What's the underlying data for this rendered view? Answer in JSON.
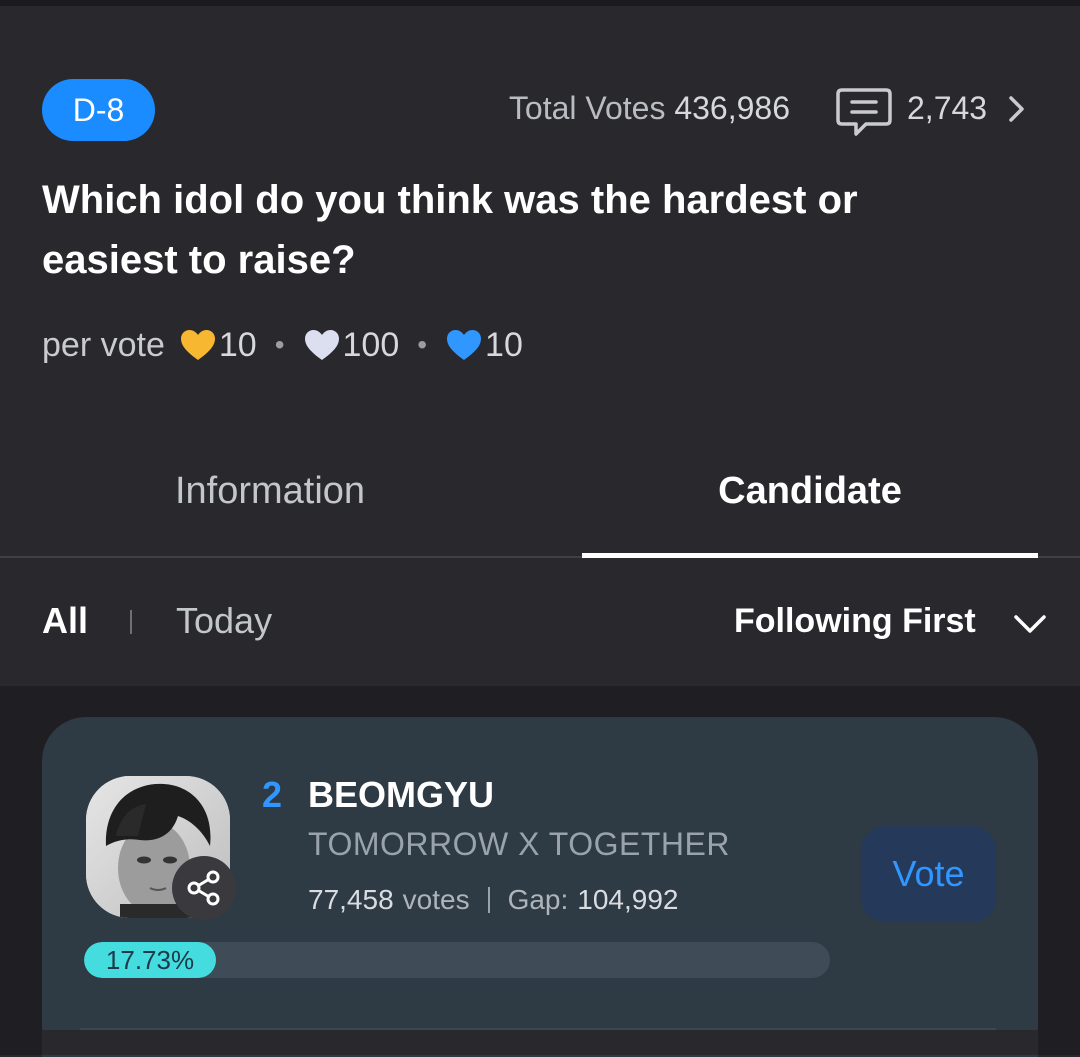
{
  "header": {
    "dday_badge": "D-8",
    "total_votes_label": "Total Votes",
    "total_votes_value": "436,986",
    "comment_count": "2,743"
  },
  "question": "Which idol do you think was the hardest or easiest to raise?",
  "per_vote": {
    "label": "per vote",
    "items": [
      {
        "heart": "gold-heart-icon",
        "color": "#f7b731",
        "value": "10"
      },
      {
        "heart": "white-heart-icon",
        "color": "#dcdff0",
        "value": "100"
      },
      {
        "heart": "blue-heart-icon",
        "color": "#2f97ff",
        "value": "10"
      }
    ]
  },
  "tabs": [
    {
      "label": "Information",
      "active": false
    },
    {
      "label": "Candidate",
      "active": true
    }
  ],
  "filters": {
    "all": "All",
    "today": "Today",
    "sort": "Following First"
  },
  "candidate": {
    "rank": "2",
    "name": "BEOMGYU",
    "group": "TOMORROW X TOGETHER",
    "votes_value": "77,458",
    "votes_suffix": "votes",
    "gap_label": "Gap:",
    "gap_value": "104,992",
    "percent_label": "17.73%",
    "percent": 17.73,
    "vote_button": "Vote"
  },
  "colors": {
    "accent_blue": "#1a8cff",
    "progress": "#44dcde",
    "background": "#28282d"
  }
}
